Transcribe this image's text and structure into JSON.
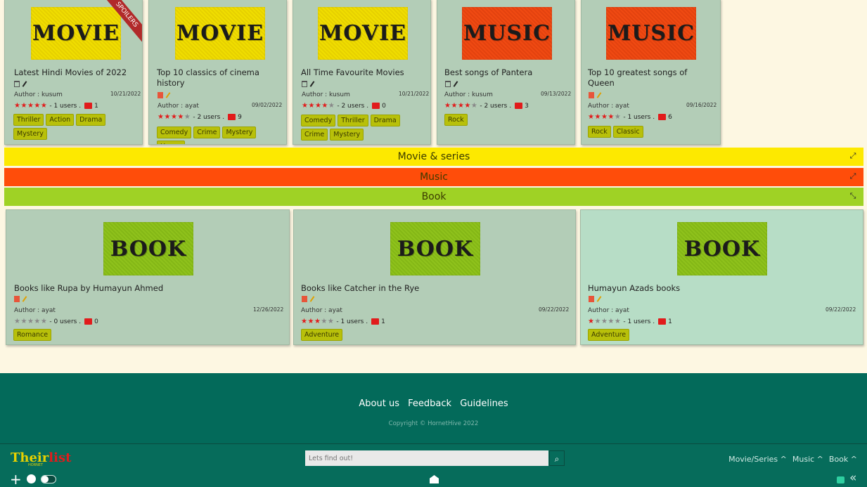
{
  "movie_cards": [
    {
      "thumb": "MOVIE",
      "spoiler": "SPOILERS",
      "title": "Latest Hindi Movies of 2022",
      "author": "Author : kusum",
      "date": "10/21/2022",
      "stars_on": 5,
      "rating_text": " - 1 users .",
      "comments": "1",
      "tags": [
        "Thriller",
        "Action",
        "Drama",
        "Mystery"
      ]
    },
    {
      "thumb": "MOVIE",
      "title": "Top 10 classics of cinema history",
      "author": "Author : ayat",
      "date": "09/02/2022",
      "stars_on": 4,
      "rating_text": " - 2 users .",
      "comments": "9",
      "tags": [
        "Comedy",
        "Crime",
        "Mystery",
        "Horror"
      ]
    },
    {
      "thumb": "MOVIE",
      "title": "All Time Favourite Movies",
      "author": "Author : kusum",
      "date": "10/21/2022",
      "stars_on": 4,
      "rating_text": " - 2 users .",
      "comments": "0",
      "tags": [
        "Comedy",
        "Thriller",
        "Drama",
        "Crime",
        "Mystery"
      ]
    },
    {
      "thumb": "MUSIC",
      "title": "Best songs of Pantera",
      "author": "Author : kusum",
      "date": "09/13/2022",
      "stars_on": 4,
      "rating_text": " - 2 users .",
      "comments": "3",
      "tags": [
        "Rock"
      ]
    },
    {
      "thumb": "MUSIC",
      "title": "Top 10 greatest songs of Queen",
      "author": "Author : ayat",
      "date": "09/16/2022",
      "stars_on": 4,
      "rating_text": " - 1 users .",
      "comments": "6",
      "tags": [
        "Rock",
        "Classic"
      ]
    }
  ],
  "sections": [
    {
      "label": "Movie & series",
      "color": "#fde900",
      "icon": "expand-icon"
    },
    {
      "label": "Music",
      "color": "#ff4d0a",
      "icon": "expand-icon"
    },
    {
      "label": "Book",
      "color": "#9fd225",
      "icon": "collapse-icon"
    }
  ],
  "book_cards": [
    {
      "thumb": "BOOK",
      "title": "Books like Rupa by Humayun Ahmed",
      "author": "Author : ayat",
      "date": "12/26/2022",
      "stars_on": 0,
      "rating_text": " - 0 users .",
      "comments": "0",
      "tags": [
        "Romance"
      ]
    },
    {
      "thumb": "BOOK",
      "title": "Books like Catcher in the Rye",
      "author": "Author : ayat",
      "date": "09/22/2022",
      "stars_on": 3,
      "rating_text": " - 1 users .",
      "comments": "1",
      "tags": [
        "Adventure"
      ]
    },
    {
      "thumb": "BOOK",
      "title": "Humayun Azads books",
      "author": "Author : ayat",
      "date": "09/22/2022",
      "stars_on": 1,
      "rating_text": " - 1 users .",
      "comments": "1",
      "tags": [
        "Adventure"
      ]
    }
  ],
  "footer": {
    "links": [
      "About us",
      "Feedback",
      "Guidelines"
    ],
    "copyright": "Copyright © HornetHive 2022"
  },
  "navbar": {
    "logo_main": "Their",
    "logo_accent": "list",
    "logo_sub": "HORNET",
    "search_placeholder": "Lets find out!",
    "links": [
      "Movie/Series ^",
      "Music ^",
      "Book ^"
    ]
  },
  "colors": {
    "card_bg": "#b3cdb7",
    "footer_bg": "#036a5a",
    "tag_bg": "#b8c00a",
    "star_on": "#e11b1b"
  }
}
